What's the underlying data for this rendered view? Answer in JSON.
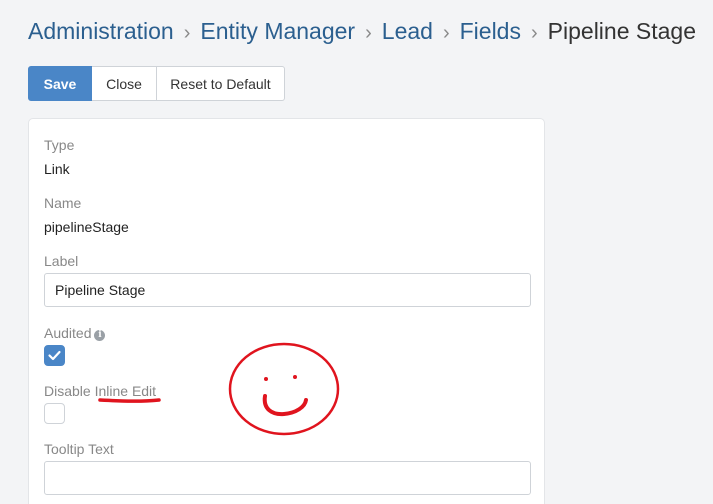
{
  "breadcrumb": {
    "items": [
      "Administration",
      "Entity Manager",
      "Lead",
      "Fields"
    ],
    "current": "Pipeline Stage",
    "separator": "›"
  },
  "toolbar": {
    "save_label": "Save",
    "close_label": "Close",
    "reset_label": "Reset to Default"
  },
  "fields": {
    "type": {
      "label": "Type",
      "value": "Link"
    },
    "name": {
      "label": "Name",
      "value": "pipelineStage"
    },
    "label": {
      "label": "Label",
      "value": "Pipeline Stage"
    },
    "audited": {
      "label": "Audited",
      "checked": true
    },
    "disable_inline_edit": {
      "label": "Disable Inline Edit",
      "checked": false
    },
    "tooltip_text": {
      "label": "Tooltip Text",
      "value": ""
    }
  },
  "colors": {
    "accent": "#4a86c7",
    "link": "#2b5f8f",
    "annotation": "#e0141e"
  },
  "icons": {
    "audited_info": "info-icon",
    "audited_check": "checkmark-icon"
  }
}
